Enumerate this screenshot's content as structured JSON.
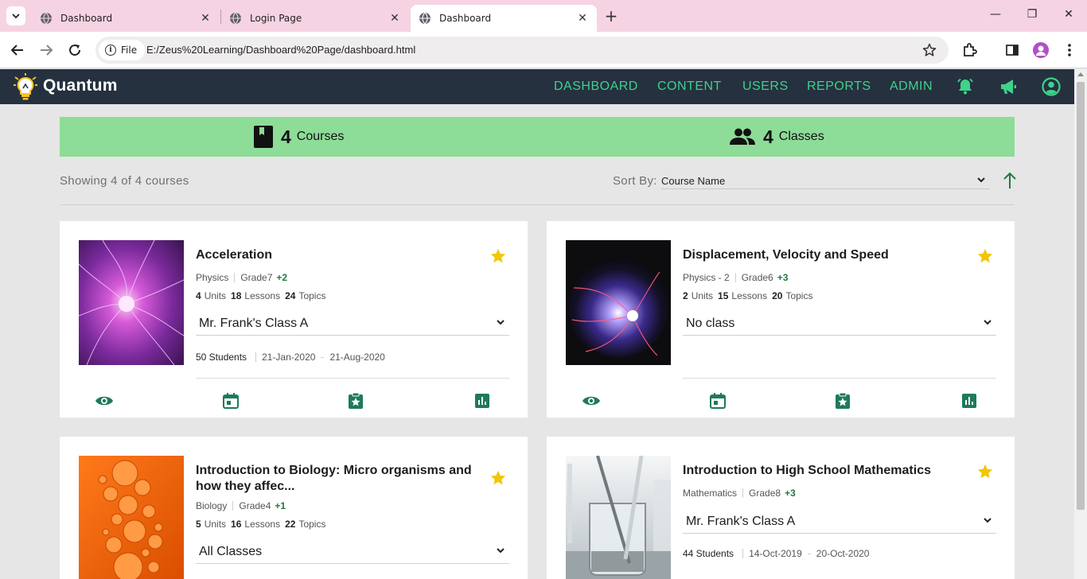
{
  "browser": {
    "tabs": [
      {
        "title": "Dashboard",
        "active": false
      },
      {
        "title": "Login Page",
        "active": false
      },
      {
        "title": "Dashboard",
        "active": true
      }
    ],
    "close_glyph": "✕",
    "new_tab_glyph": "+",
    "file_chip": "File",
    "url": "E:/Zeus%20Learning/Dashboard%20Page/dashboard.html",
    "window_controls": {
      "minimize": "—",
      "restore": "❐",
      "close": "✕"
    }
  },
  "app": {
    "brand": "Quantum",
    "nav": [
      {
        "label": "DASHBOARD",
        "active": true
      },
      {
        "label": "CONTENT",
        "active": false
      },
      {
        "label": "USERS",
        "active": false
      },
      {
        "label": "REPORTS",
        "active": false
      },
      {
        "label": "ADMIN",
        "active": false
      }
    ],
    "accent_color": "#3fd28b",
    "header_color": "#25313f"
  },
  "summary": {
    "courses_count": "4",
    "courses_label": "Courses",
    "classes_count": "4",
    "classes_label": "Classes",
    "banner_color": "#8ddc97"
  },
  "listing": {
    "showing_text": "Showing 4 of 4 courses",
    "sort_label": "Sort By:",
    "sort_value": "Course Name"
  },
  "courses": [
    {
      "title": "Acceleration",
      "subject": "Physics",
      "grade": "Grade7",
      "grade_extra": "+2",
      "units": "4",
      "units_label": "Units",
      "lessons": "18",
      "lessons_label": "Lessons",
      "topics": "24",
      "topics_label": "Topics",
      "class": "Mr. Frank's Class A",
      "students": "50 Students",
      "start": "21-Jan-2020",
      "end": "21-Aug-2020",
      "favorite": true
    },
    {
      "title": "Displacement, Velocity and Speed",
      "subject": "Physics - 2",
      "grade": "Grade6",
      "grade_extra": "+3",
      "units": "2",
      "units_label": "Units",
      "lessons": "15",
      "lessons_label": "Lessons",
      "topics": "20",
      "topics_label": "Topics",
      "class": "No class",
      "favorite": true
    },
    {
      "title": "Introduction to Biology: Micro organisms and how they affec...",
      "subject": "Biology",
      "grade": "Grade4",
      "grade_extra": "+1",
      "units": "5",
      "units_label": "Units",
      "lessons": "16",
      "lessons_label": "Lessons",
      "topics": "22",
      "topics_label": "Topics",
      "class": "All Classes",
      "favorite": true
    },
    {
      "title": "Introduction to High School Mathematics",
      "subject": "Mathematics",
      "grade": "Grade8",
      "grade_extra": "+3",
      "class": "Mr. Frank's Class A",
      "students": "44 Students",
      "start": "14-Oct-2019",
      "end": "20-Oct-2020",
      "favorite": true
    }
  ]
}
